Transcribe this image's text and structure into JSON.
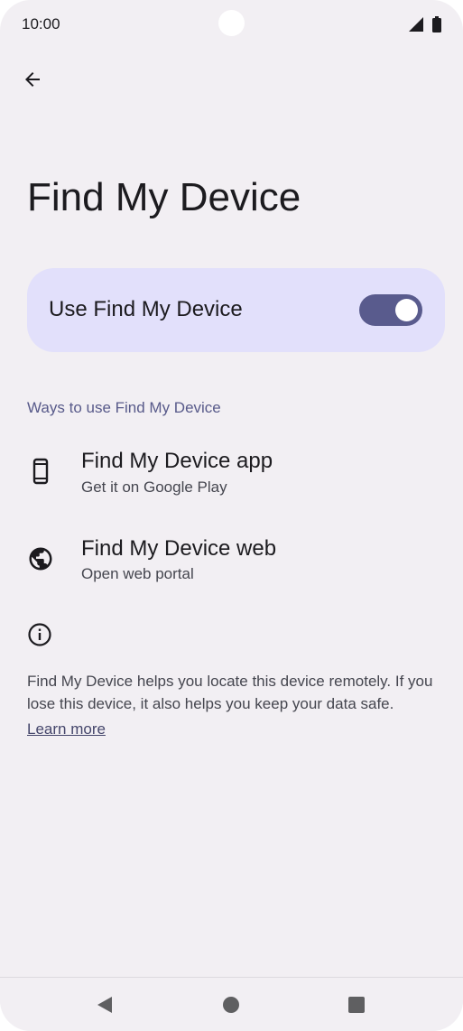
{
  "status_bar": {
    "time": "10:00"
  },
  "header": {
    "title": "Find My Device"
  },
  "main_toggle": {
    "label": "Use Find My Device",
    "checked": true
  },
  "section": {
    "header": "Ways to use Find My Device"
  },
  "items": [
    {
      "title": "Find My Device app",
      "subtitle": "Get it on Google Play",
      "icon": "phone-icon"
    },
    {
      "title": "Find My Device web",
      "subtitle": "Open web portal",
      "icon": "globe-icon"
    }
  ],
  "info": {
    "text": "Find My Device helps you locate this device remotely. If you lose this device, it also helps you keep your data safe.",
    "link": "Learn more"
  },
  "colors": {
    "background": "#f2eff3",
    "card": "#e2e0fb",
    "switch_track": "#595b8d",
    "accent_text": "#585a8a"
  }
}
